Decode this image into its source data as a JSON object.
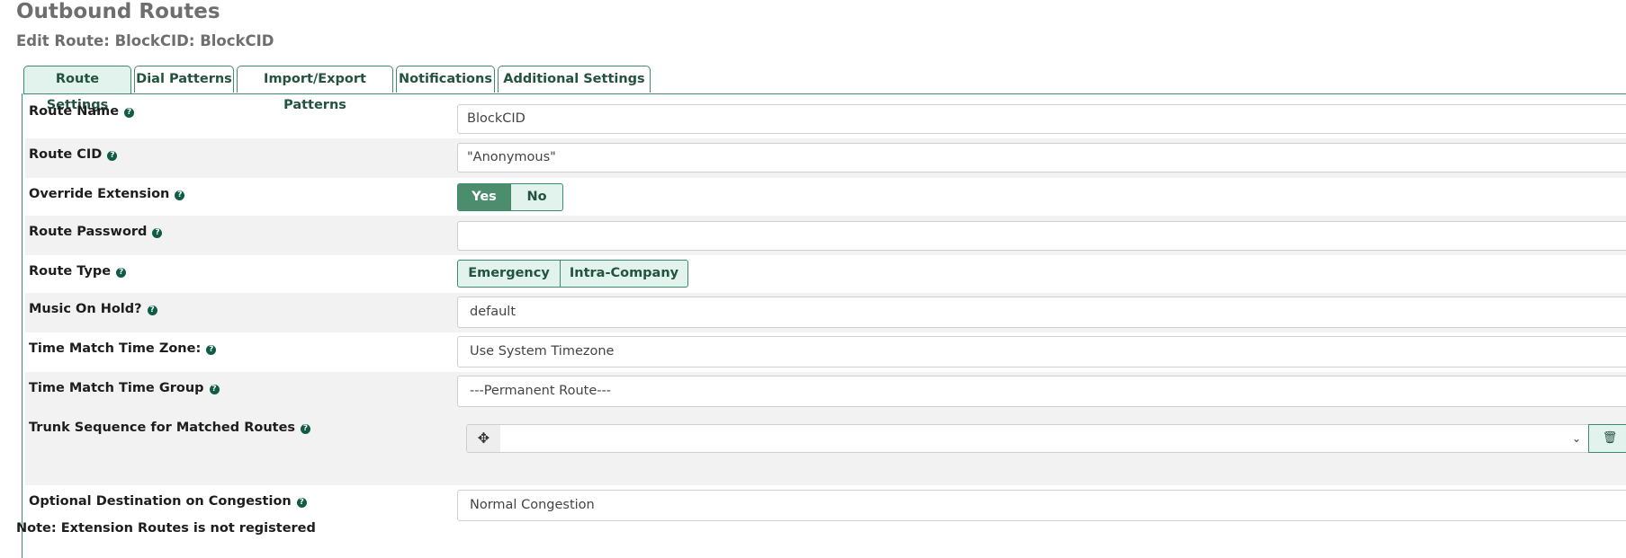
{
  "page": {
    "title": "Outbound Routes",
    "subtitle": "Edit Route: BlockCID: BlockCID"
  },
  "tabs": [
    {
      "label": "Route Settings",
      "active": true
    },
    {
      "label": "Dial Patterns",
      "active": false
    },
    {
      "label": "Import/Export Patterns",
      "active": false
    },
    {
      "label": "Notifications",
      "active": false
    },
    {
      "label": "Additional Settings",
      "active": false
    }
  ],
  "form": {
    "route_name": {
      "label": "Route Name",
      "value": "BlockCID"
    },
    "route_cid": {
      "label": "Route CID",
      "value": "\"Anonymous\""
    },
    "override_extension": {
      "label": "Override Extension",
      "options": [
        "Yes",
        "No"
      ],
      "selected": "Yes"
    },
    "route_password": {
      "label": "Route Password",
      "value": ""
    },
    "route_type": {
      "label": "Route Type",
      "options": [
        "Emergency",
        "Intra-Company"
      ],
      "selected": ""
    },
    "music_on_hold": {
      "label": "Music On Hold?",
      "value": "default"
    },
    "time_zone": {
      "label": "Time Match Time Zone:",
      "value": "Use System Timezone"
    },
    "time_group": {
      "label": "Time Match Time Group",
      "value": "---Permanent Route---"
    },
    "trunk_sequence": {
      "label": "Trunk Sequence for Matched Routes",
      "value": ""
    },
    "congestion": {
      "label": "Optional Destination on Congestion",
      "value": "Normal Congestion"
    }
  },
  "icons": {
    "help": "help-icon",
    "move": "move-icon",
    "trash": "trash-icon",
    "caret": "chevron-down-icon"
  },
  "colors": {
    "accent": "#3e8a6c",
    "tab_active_bg": "#e2f2ec",
    "toggle_on_bg": "#4c8d6e",
    "help_icon": "#0e5c45",
    "row_alt_bg": "#f2f2f2"
  },
  "note": "Note: Extension Routes is not registered"
}
